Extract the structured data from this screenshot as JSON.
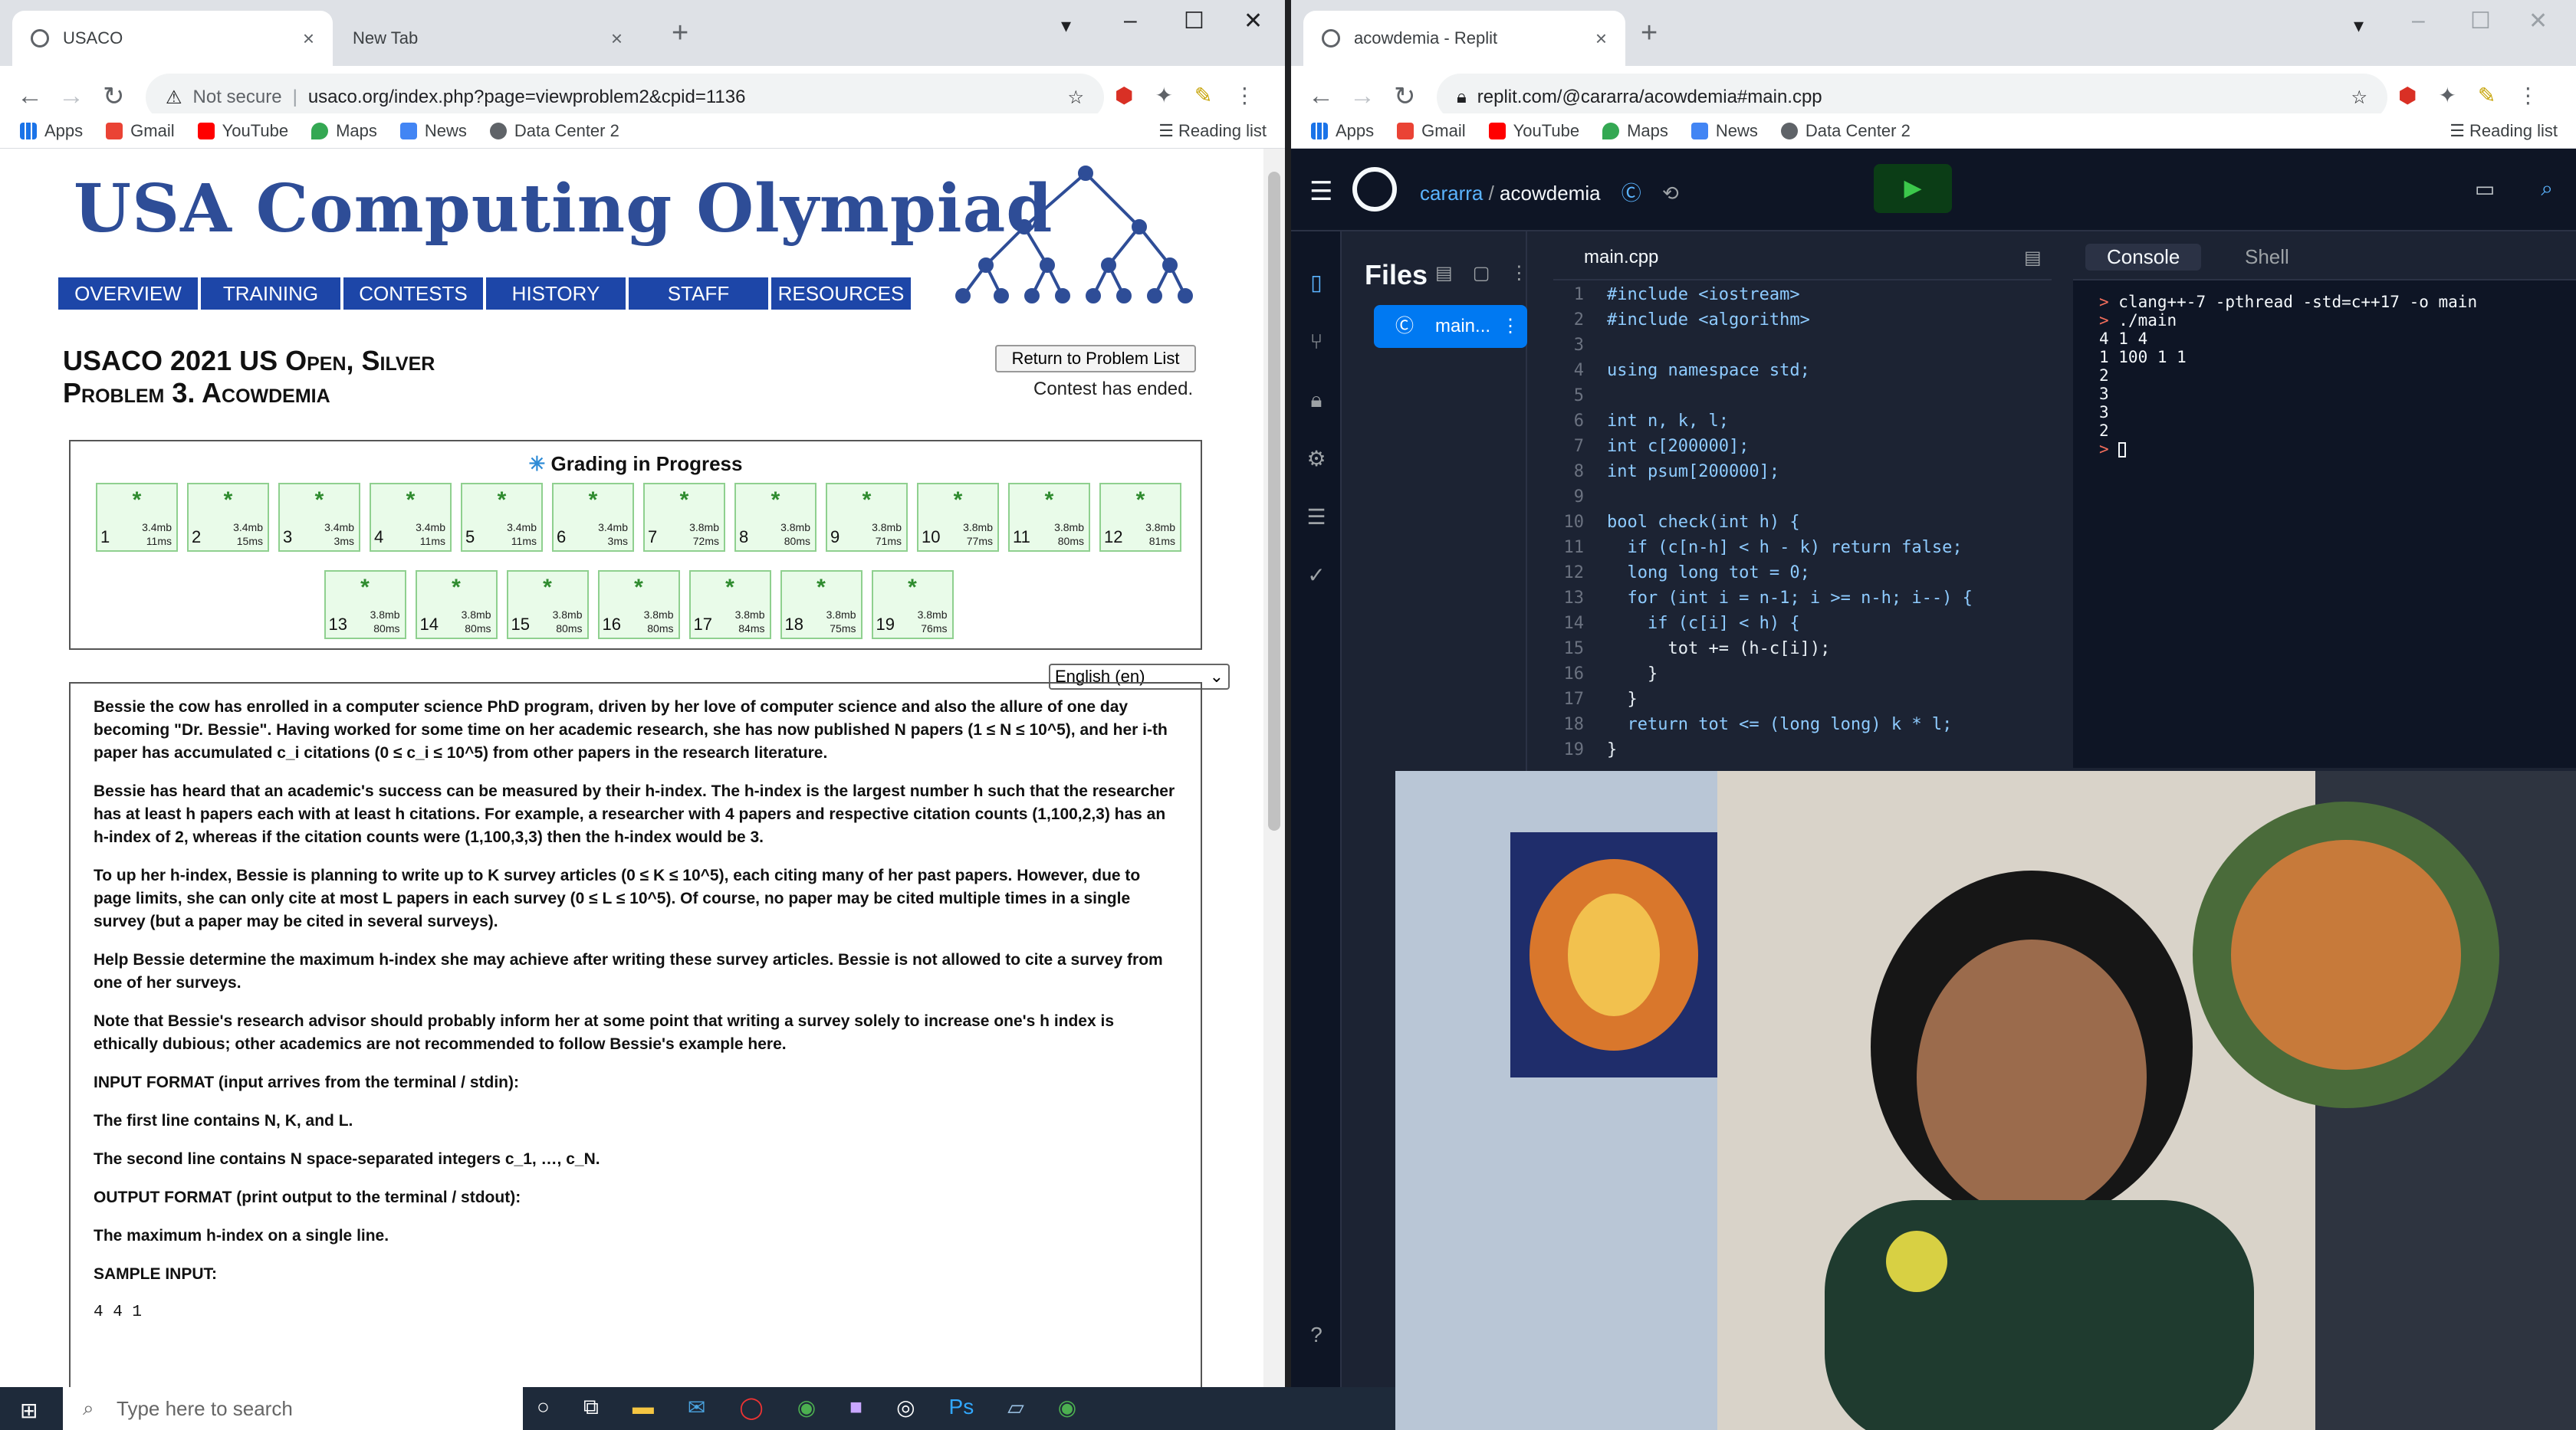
{
  "left_browser": {
    "tabs": [
      {
        "title": "USACO"
      },
      {
        "title": "New Tab"
      }
    ],
    "url_prefix": "Not secure",
    "url": "usaco.org/index.php?page=viewproblem2&cpid=1136",
    "bookmarks": [
      "Apps",
      "Gmail",
      "YouTube",
      "Maps",
      "News",
      "Data Center 2"
    ],
    "reading_list": "Reading list"
  },
  "usaco": {
    "logo": "USA Computing Olympiad",
    "nav": [
      "Overview",
      "Training",
      "Contests",
      "History",
      "Staff",
      "Resources"
    ],
    "title_line1": "USACO 2021 US Open, Silver",
    "title_line2": "Problem 3. Acowdemia",
    "return_button": "Return to Problem List",
    "contest_status": "Contest has ended.",
    "grading_title": "Grading in Progress",
    "tests": [
      {
        "n": "1",
        "mem": "3.4mb",
        "time": "11ms"
      },
      {
        "n": "2",
        "mem": "3.4mb",
        "time": "15ms"
      },
      {
        "n": "3",
        "mem": "3.4mb",
        "time": "3ms"
      },
      {
        "n": "4",
        "mem": "3.4mb",
        "time": "11ms"
      },
      {
        "n": "5",
        "mem": "3.4mb",
        "time": "11ms"
      },
      {
        "n": "6",
        "mem": "3.4mb",
        "time": "3ms"
      },
      {
        "n": "7",
        "mem": "3.8mb",
        "time": "72ms"
      },
      {
        "n": "8",
        "mem": "3.8mb",
        "time": "80ms"
      },
      {
        "n": "9",
        "mem": "3.8mb",
        "time": "71ms"
      },
      {
        "n": "10",
        "mem": "3.8mb",
        "time": "77ms"
      },
      {
        "n": "11",
        "mem": "3.8mb",
        "time": "80ms"
      },
      {
        "n": "12",
        "mem": "3.8mb",
        "time": "81ms"
      },
      {
        "n": "13",
        "mem": "3.8mb",
        "time": "80ms"
      },
      {
        "n": "14",
        "mem": "3.8mb",
        "time": "80ms"
      },
      {
        "n": "15",
        "mem": "3.8mb",
        "time": "80ms"
      },
      {
        "n": "16",
        "mem": "3.8mb",
        "time": "80ms"
      },
      {
        "n": "17",
        "mem": "3.8mb",
        "time": "84ms"
      },
      {
        "n": "18",
        "mem": "3.8mb",
        "time": "75ms"
      },
      {
        "n": "19",
        "mem": "3.8mb",
        "time": "76ms"
      }
    ],
    "language": "English (en)",
    "statement": [
      "Bessie the cow has enrolled in a computer science PhD program, driven by her love of computer science and also the allure of one day becoming \"Dr. Bessie\". Having worked for some time on her academic research, she has now published N papers (1 ≤ N ≤ 10^5), and her i-th paper has accumulated c_i citations (0 ≤ c_i ≤ 10^5) from other papers in the research literature.",
      "Bessie has heard that an academic's success can be measured by their h-index. The h-index is the largest number h such that the researcher has at least h papers each with at least h citations. For example, a researcher with 4 papers and respective citation counts (1,100,2,3) has an h-index of 2, whereas if the citation counts were (1,100,3,3) then the h-index would be 3.",
      "To up her h-index, Bessie is planning to write up to K survey articles (0 ≤ K ≤ 10^5), each citing many of her past papers. However, due to page limits, she can only cite at most L papers in each survey (0 ≤ L ≤ 10^5). Of course, no paper may be cited multiple times in a single survey (but a paper may be cited in several surveys).",
      "Help Bessie determine the maximum h-index she may achieve after writing these survey articles. Bessie is not allowed to cite a survey from one of her surveys.",
      "Note that Bessie's research advisor should probably inform her at some point that writing a survey solely to increase one's h index is ethically dubious; other academics are not recommended to follow Bessie's example here.",
      "INPUT FORMAT (input arrives from the terminal / stdin):",
      "The first line contains N, K, and L.",
      "The second line contains N space-separated integers c_1, …, c_N.",
      "OUTPUT FORMAT (print output to the terminal / stdout):",
      "The maximum h-index on a single line.",
      "SAMPLE INPUT:"
    ],
    "sample_input": "4 4 1"
  },
  "right_browser": {
    "tabs": [
      {
        "title": "acowdemia - Replit"
      }
    ],
    "url": "replit.com/@cararra/acowdemia#main.cpp",
    "bookmarks": [
      "Apps",
      "Gmail",
      "YouTube",
      "Maps",
      "News",
      "Data Center 2"
    ],
    "reading_list": "Reading list"
  },
  "replit": {
    "user": "cararra",
    "repl": "acowdemia",
    "files_title": "Files",
    "file": "main...",
    "editor_tab": "main.cpp",
    "console_tab": "Console",
    "shell_tab": "Shell",
    "code_lines": [
      "#include <iostream>",
      "#include <algorithm>",
      "",
      "using namespace std;",
      "",
      "int n, k, l;",
      "int c[200000];",
      "int psum[200000];",
      "",
      "bool check(int h) {",
      "  if (c[n-h] < h - k) return false;",
      "  long long tot = 0;",
      "  for (int i = n-1; i >= n-h; i--) {",
      "    if (c[i] < h) {",
      "      tot += (h-c[i]);",
      "    }",
      "  }",
      "  return tot <= (long long) k * l;",
      "}"
    ],
    "console_lines": [
      "clang++-7 -pthread -std=c++17 -o main",
      "./main",
      "4 1 4",
      "1 100 1 1",
      "2",
      "3",
      "3",
      "2"
    ]
  },
  "taskbar": {
    "search_placeholder": "Type here to search"
  }
}
